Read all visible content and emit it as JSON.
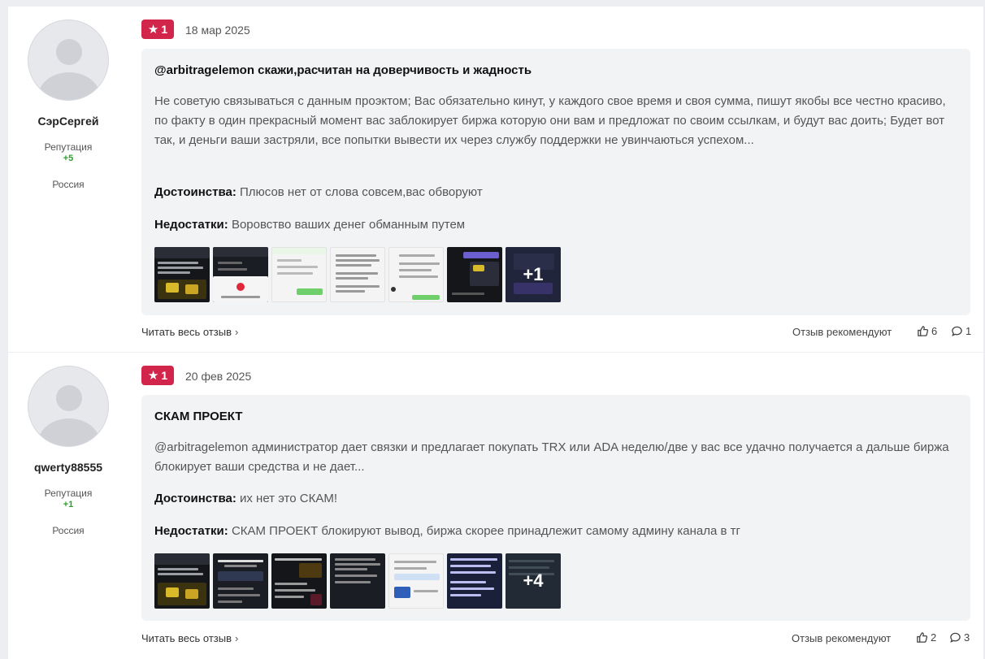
{
  "reviews": [
    {
      "author": "СэрСергей",
      "rep_label": "Репутация",
      "rep_value": "+5",
      "country": "Россия",
      "rating": "1",
      "date": "18 мар 2025",
      "title": "@arbitragelemon скажи,расчитан на доверчивость и жадность",
      "text": "Не советую связываться с данным проэктом; Вас обязательно кинут, у каждого свое время и своя сумма, пишут якобы все честно красиво, по факту в один прекрасный момент вас заблокирует биржа которую они вам и предложат по своим ссылкам, и будут вас доить; Будет вот так, и деньги ваши застряли, все попытки вывести их через службу поддержки не увинчаються успехом...",
      "pros_label": "Достоинства:",
      "pros": "Плюсов нет от слова совсем,вас обворуют",
      "cons_label": "Недостатки:",
      "cons": "Воровство ваших денег обманным путем",
      "more_photos": "+1",
      "read_more": "Читать весь отзыв",
      "recommend": "Отзыв рекомендуют",
      "likes": "6",
      "comments": "1"
    },
    {
      "author": "qwerty88555",
      "rep_label": "Репутация",
      "rep_value": "+1",
      "country": "Россия",
      "rating": "1",
      "date": "20 фев 2025",
      "title": "СКАМ ПРОЕКТ",
      "text": "@arbitragelemon администратор дает связки и предлагает покупать TRX или ADA неделю/две у вас все удачно получается а дальше биржа блокирует ваши средства и не дает...",
      "pros_label": "Достоинства:",
      "pros": "их нет это СКАМ!",
      "cons_label": "Недостатки:",
      "cons": "СКАМ ПРОЕКТ блокируют вывод, биржа скорее принадлежит самому админу канала в тг",
      "more_photos": "+4",
      "read_more": "Читать весь отзыв",
      "recommend": "Отзыв рекомендуют",
      "likes": "2",
      "comments": "3"
    }
  ],
  "colors": {
    "rating_badge": "#d2254b",
    "reputation": "#2ca02c",
    "card_bg": "#f2f3f5"
  },
  "icons": [
    "star-icon",
    "chevron-right-icon",
    "thumbs-up-icon",
    "comment-icon",
    "avatar-placeholder-icon"
  ]
}
